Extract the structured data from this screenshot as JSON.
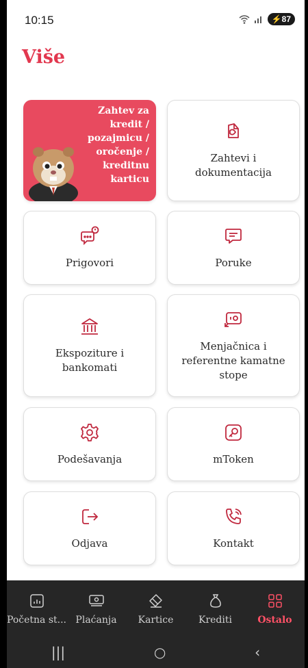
{
  "status": {
    "time": "10:15",
    "battery": "87"
  },
  "page": {
    "title": "Više"
  },
  "cards": {
    "promo": "Zahtev za kredit / pozajmicu / oročenje / kreditnu karticu",
    "requests": "Zahtevi i dokumentacija",
    "complaints": "Prigovori",
    "messages": "Poruke",
    "branches": "Ekspoziture i bankomati",
    "exchange": "Menjačnica i referentne kamatne stope",
    "settings": "Podešavanja",
    "mtoken": "mToken",
    "logout": "Odjava",
    "contact": "Kontakt"
  },
  "nav": [
    {
      "label": "Početna st..."
    },
    {
      "label": "Plaćanja"
    },
    {
      "label": "Kartice"
    },
    {
      "label": "Krediti"
    },
    {
      "label": "Ostalo"
    }
  ],
  "colors": {
    "accent": "#e2384f",
    "promo_bg": "#e84a5f",
    "nav_bg": "#262626",
    "nav_active": "#ff5166"
  },
  "icons": {
    "requests": "documents-icon",
    "complaints": "chat-alert-icon",
    "messages": "message-icon",
    "branches": "bank-icon",
    "exchange": "exchange-icon",
    "settings": "gear-icon",
    "mtoken": "key-icon",
    "logout": "logout-icon",
    "contact": "phone-icon"
  }
}
